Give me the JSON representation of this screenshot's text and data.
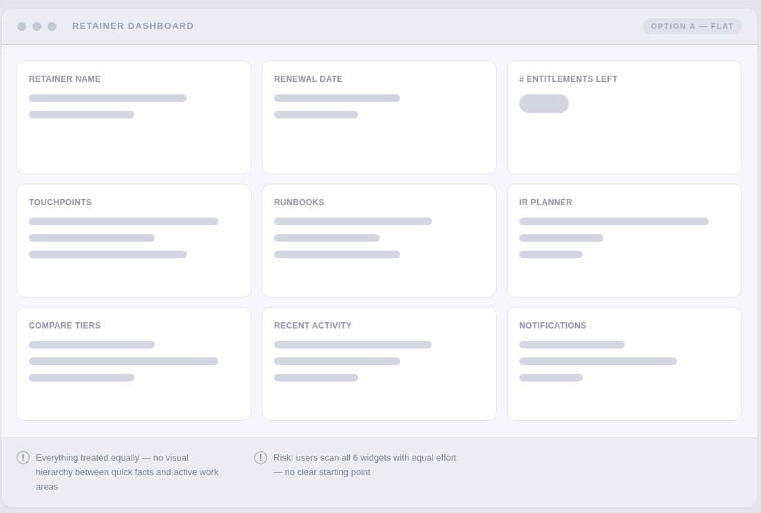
{
  "window": {
    "title": "RETAINER DASHBOARD",
    "badge": "OPTION A — FLAT"
  },
  "widgets": [
    {
      "title": "RETAINER NAME",
      "placeholders": [
        {
          "kind": "long"
        },
        {
          "kind": "half"
        }
      ]
    },
    {
      "title": "RENEWAL DATE",
      "placeholders": [
        {
          "kind": "medium"
        },
        {
          "kind": "short"
        }
      ]
    },
    {
      "title": "# ENTITLEMENTS LEFT",
      "placeholders": [
        {
          "kind": "pill"
        }
      ]
    },
    {
      "title": "TOUCHPOINTS",
      "placeholders": [
        {
          "kind": "full"
        },
        {
          "kind": "medium"
        },
        {
          "kind": "long"
        }
      ]
    },
    {
      "title": "RUNBOOKS",
      "placeholders": [
        {
          "kind": "long"
        },
        {
          "kind": "half"
        },
        {
          "kind": "medium"
        }
      ]
    },
    {
      "title": "IR PLANNER",
      "placeholders": [
        {
          "kind": "full"
        },
        {
          "kind": "short"
        },
        {
          "kind": "tiny"
        }
      ]
    },
    {
      "title": "COMPARE TIERS",
      "placeholders": [
        {
          "kind": "medium"
        },
        {
          "kind": "full"
        },
        {
          "kind": "half"
        }
      ]
    },
    {
      "title": "RECENT ACTIVITY",
      "placeholders": [
        {
          "kind": "long"
        },
        {
          "kind": "medium"
        },
        {
          "kind": "short"
        }
      ]
    },
    {
      "title": "NOTIFICATIONS",
      "placeholders": [
        {
          "kind": "half"
        },
        {
          "kind": "long"
        },
        {
          "kind": "tiny"
        }
      ]
    }
  ],
  "notes": [
    {
      "text": "Everything treated equally — no visual hierarchy between quick facts and active work areas"
    },
    {
      "text": "Risk: users scan all 6 widgets with equal effort — no clear starting point"
    }
  ]
}
